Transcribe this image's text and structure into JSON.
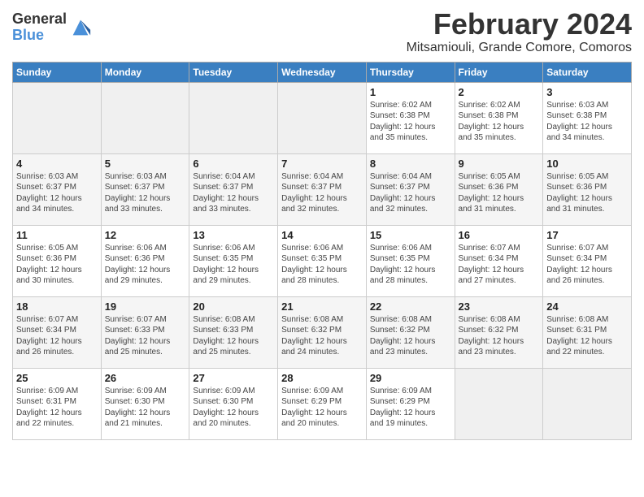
{
  "logo": {
    "text_general": "General",
    "text_blue": "Blue"
  },
  "title": "February 2024",
  "subtitle": "Mitsamiouli, Grande Comore, Comoros",
  "days_of_week": [
    "Sunday",
    "Monday",
    "Tuesday",
    "Wednesday",
    "Thursday",
    "Friday",
    "Saturday"
  ],
  "weeks": [
    [
      {
        "day": "",
        "info": ""
      },
      {
        "day": "",
        "info": ""
      },
      {
        "day": "",
        "info": ""
      },
      {
        "day": "",
        "info": ""
      },
      {
        "day": "1",
        "info": "Sunrise: 6:02 AM\nSunset: 6:38 PM\nDaylight: 12 hours\nand 35 minutes."
      },
      {
        "day": "2",
        "info": "Sunrise: 6:02 AM\nSunset: 6:38 PM\nDaylight: 12 hours\nand 35 minutes."
      },
      {
        "day": "3",
        "info": "Sunrise: 6:03 AM\nSunset: 6:38 PM\nDaylight: 12 hours\nand 34 minutes."
      }
    ],
    [
      {
        "day": "4",
        "info": "Sunrise: 6:03 AM\nSunset: 6:37 PM\nDaylight: 12 hours\nand 34 minutes."
      },
      {
        "day": "5",
        "info": "Sunrise: 6:03 AM\nSunset: 6:37 PM\nDaylight: 12 hours\nand 33 minutes."
      },
      {
        "day": "6",
        "info": "Sunrise: 6:04 AM\nSunset: 6:37 PM\nDaylight: 12 hours\nand 33 minutes."
      },
      {
        "day": "7",
        "info": "Sunrise: 6:04 AM\nSunset: 6:37 PM\nDaylight: 12 hours\nand 32 minutes."
      },
      {
        "day": "8",
        "info": "Sunrise: 6:04 AM\nSunset: 6:37 PM\nDaylight: 12 hours\nand 32 minutes."
      },
      {
        "day": "9",
        "info": "Sunrise: 6:05 AM\nSunset: 6:36 PM\nDaylight: 12 hours\nand 31 minutes."
      },
      {
        "day": "10",
        "info": "Sunrise: 6:05 AM\nSunset: 6:36 PM\nDaylight: 12 hours\nand 31 minutes."
      }
    ],
    [
      {
        "day": "11",
        "info": "Sunrise: 6:05 AM\nSunset: 6:36 PM\nDaylight: 12 hours\nand 30 minutes."
      },
      {
        "day": "12",
        "info": "Sunrise: 6:06 AM\nSunset: 6:36 PM\nDaylight: 12 hours\nand 29 minutes."
      },
      {
        "day": "13",
        "info": "Sunrise: 6:06 AM\nSunset: 6:35 PM\nDaylight: 12 hours\nand 29 minutes."
      },
      {
        "day": "14",
        "info": "Sunrise: 6:06 AM\nSunset: 6:35 PM\nDaylight: 12 hours\nand 28 minutes."
      },
      {
        "day": "15",
        "info": "Sunrise: 6:06 AM\nSunset: 6:35 PM\nDaylight: 12 hours\nand 28 minutes."
      },
      {
        "day": "16",
        "info": "Sunrise: 6:07 AM\nSunset: 6:34 PM\nDaylight: 12 hours\nand 27 minutes."
      },
      {
        "day": "17",
        "info": "Sunrise: 6:07 AM\nSunset: 6:34 PM\nDaylight: 12 hours\nand 26 minutes."
      }
    ],
    [
      {
        "day": "18",
        "info": "Sunrise: 6:07 AM\nSunset: 6:34 PM\nDaylight: 12 hours\nand 26 minutes."
      },
      {
        "day": "19",
        "info": "Sunrise: 6:07 AM\nSunset: 6:33 PM\nDaylight: 12 hours\nand 25 minutes."
      },
      {
        "day": "20",
        "info": "Sunrise: 6:08 AM\nSunset: 6:33 PM\nDaylight: 12 hours\nand 25 minutes."
      },
      {
        "day": "21",
        "info": "Sunrise: 6:08 AM\nSunset: 6:32 PM\nDaylight: 12 hours\nand 24 minutes."
      },
      {
        "day": "22",
        "info": "Sunrise: 6:08 AM\nSunset: 6:32 PM\nDaylight: 12 hours\nand 23 minutes."
      },
      {
        "day": "23",
        "info": "Sunrise: 6:08 AM\nSunset: 6:32 PM\nDaylight: 12 hours\nand 23 minutes."
      },
      {
        "day": "24",
        "info": "Sunrise: 6:08 AM\nSunset: 6:31 PM\nDaylight: 12 hours\nand 22 minutes."
      }
    ],
    [
      {
        "day": "25",
        "info": "Sunrise: 6:09 AM\nSunset: 6:31 PM\nDaylight: 12 hours\nand 22 minutes."
      },
      {
        "day": "26",
        "info": "Sunrise: 6:09 AM\nSunset: 6:30 PM\nDaylight: 12 hours\nand 21 minutes."
      },
      {
        "day": "27",
        "info": "Sunrise: 6:09 AM\nSunset: 6:30 PM\nDaylight: 12 hours\nand 20 minutes."
      },
      {
        "day": "28",
        "info": "Sunrise: 6:09 AM\nSunset: 6:29 PM\nDaylight: 12 hours\nand 20 minutes."
      },
      {
        "day": "29",
        "info": "Sunrise: 6:09 AM\nSunset: 6:29 PM\nDaylight: 12 hours\nand 19 minutes."
      },
      {
        "day": "",
        "info": ""
      },
      {
        "day": "",
        "info": ""
      }
    ]
  ]
}
